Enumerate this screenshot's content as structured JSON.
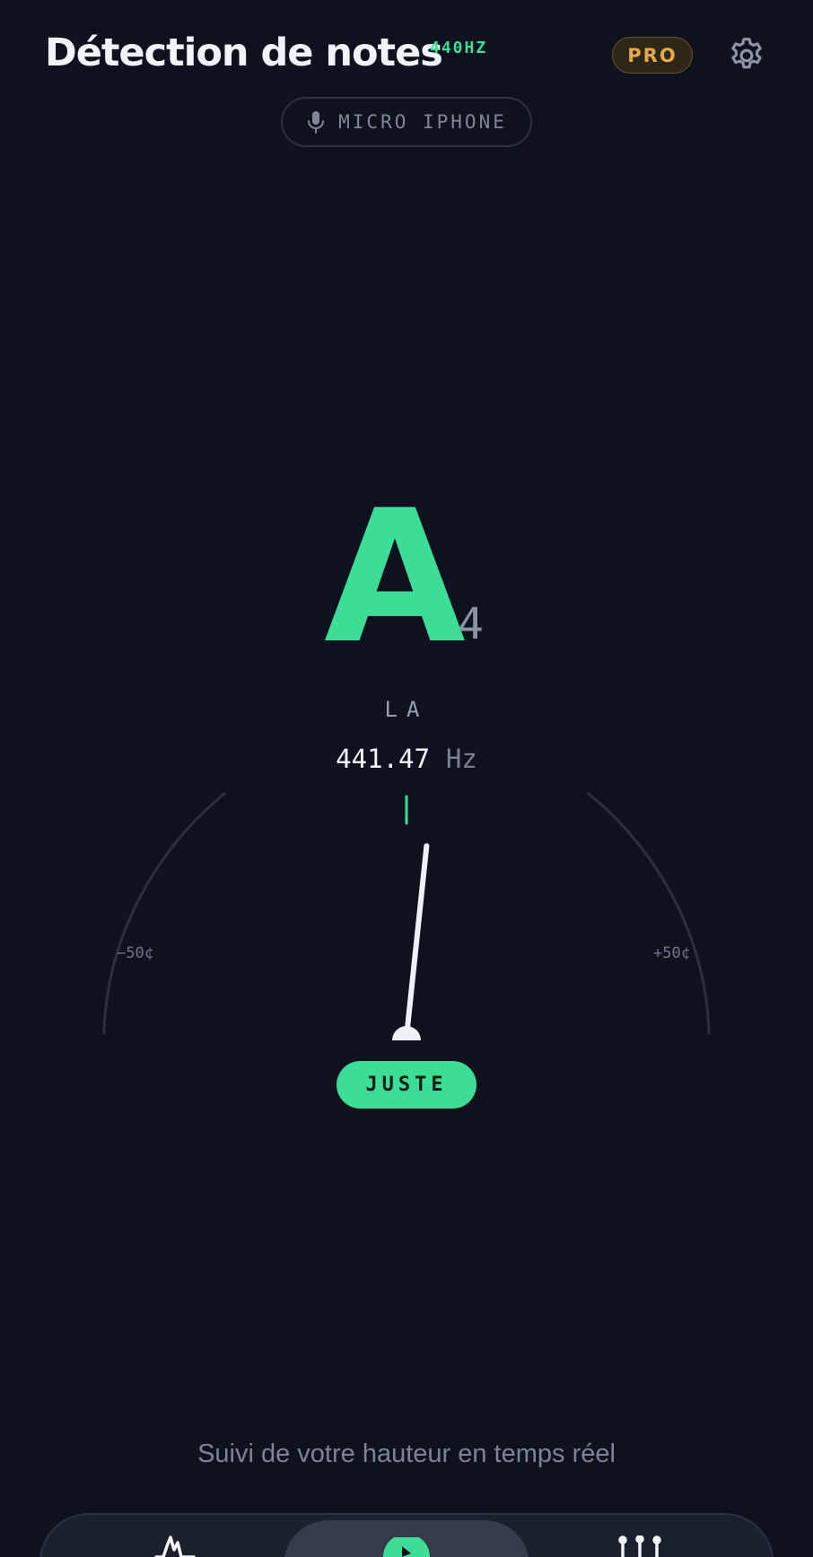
{
  "header": {
    "title": "Détection de notes",
    "reference": "440HZ",
    "pro_badge": "PRO",
    "settings_icon": "gear-icon"
  },
  "input": {
    "icon": "microphone-icon",
    "label": "MICRO IPHONE"
  },
  "tuner": {
    "note": "A",
    "octave": "4",
    "note_name": "LA",
    "frequency": "441.47",
    "frequency_unit": "Hz",
    "cents_min_label": "−50¢",
    "cents_max_label": "+50¢",
    "cents_min": -50,
    "cents_max": 50,
    "needle_cents": 6,
    "status": "JUSTE"
  },
  "footer": {
    "hint": "Suivi de votre hauteur en temps réel"
  },
  "tabs": [
    {
      "icon": "waveform-icon",
      "active": false
    },
    {
      "icon": "tuner-icon",
      "active": true
    },
    {
      "icon": "sliders-icon",
      "active": false
    }
  ],
  "colors": {
    "background": "#0d121e",
    "accent": "#3ddc97",
    "pro": "#e6a94a",
    "muted": "#7c8494",
    "needle": "#eef1f8"
  }
}
